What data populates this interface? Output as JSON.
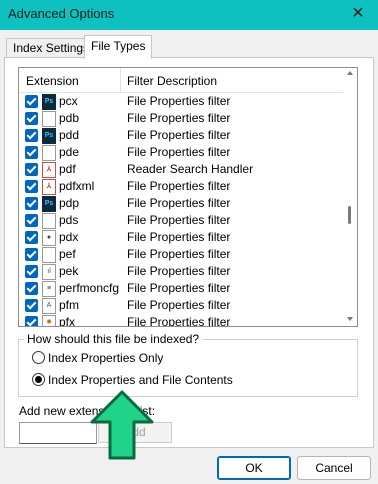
{
  "window": {
    "title": "Advanced Options",
    "close_glyph": "✕"
  },
  "tabs": [
    {
      "label": "Index Settings",
      "active": false
    },
    {
      "label": "File Types",
      "active": true
    }
  ],
  "file_list": {
    "headers": {
      "extension": "Extension",
      "description": "Filter Description"
    },
    "rows": [
      {
        "ext": "pcx",
        "desc": "File Properties filter",
        "icon": "photoshop-icon",
        "checked": true
      },
      {
        "ext": "pdb",
        "desc": "File Properties filter",
        "icon": "blank-file-icon",
        "checked": true
      },
      {
        "ext": "pdd",
        "desc": "File Properties filter",
        "icon": "photoshop-icon",
        "checked": true
      },
      {
        "ext": "pde",
        "desc": "File Properties filter",
        "icon": "blank-file-icon",
        "checked": true
      },
      {
        "ext": "pdf",
        "desc": "Reader Search Handler",
        "icon": "pdf-icon",
        "checked": true
      },
      {
        "ext": "pdfxml",
        "desc": "File Properties filter",
        "icon": "pdf-icon",
        "checked": true
      },
      {
        "ext": "pdp",
        "desc": "File Properties filter",
        "icon": "photoshop-icon",
        "checked": true
      },
      {
        "ext": "pds",
        "desc": "File Properties filter",
        "icon": "blank-file-icon",
        "checked": true
      },
      {
        "ext": "pdx",
        "desc": "File Properties filter",
        "icon": "camera-file-icon",
        "checked": true
      },
      {
        "ext": "pef",
        "desc": "File Properties filter",
        "icon": "blank-file-icon",
        "checked": true
      },
      {
        "ext": "pek",
        "desc": "File Properties filter",
        "icon": "audio-file-icon",
        "checked": true
      },
      {
        "ext": "perfmoncfg",
        "desc": "File Properties filter",
        "icon": "document-file-icon",
        "checked": true
      },
      {
        "ext": "pfm",
        "desc": "File Properties filter",
        "icon": "font-file-icon",
        "checked": true
      },
      {
        "ext": "pfx",
        "desc": "File Properties filter",
        "icon": "certificate-file-icon",
        "checked": true
      }
    ]
  },
  "index_group": {
    "label": "How should this file be indexed?",
    "options": [
      {
        "label": "Index Properties Only",
        "selected": false
      },
      {
        "label": "Index Properties and File Contents",
        "selected": true
      }
    ]
  },
  "add_extension": {
    "label": "Add new extension to list:",
    "value": "",
    "button_label": "Add"
  },
  "footer": {
    "ok_label": "OK",
    "cancel_label": "Cancel"
  },
  "overlay": {
    "arrow_color": "#1fd38a",
    "arrow_outline": "#0b6b3e"
  },
  "colors": {
    "titlebar": "#0dc1c1",
    "checkbox": "#0067c0"
  }
}
